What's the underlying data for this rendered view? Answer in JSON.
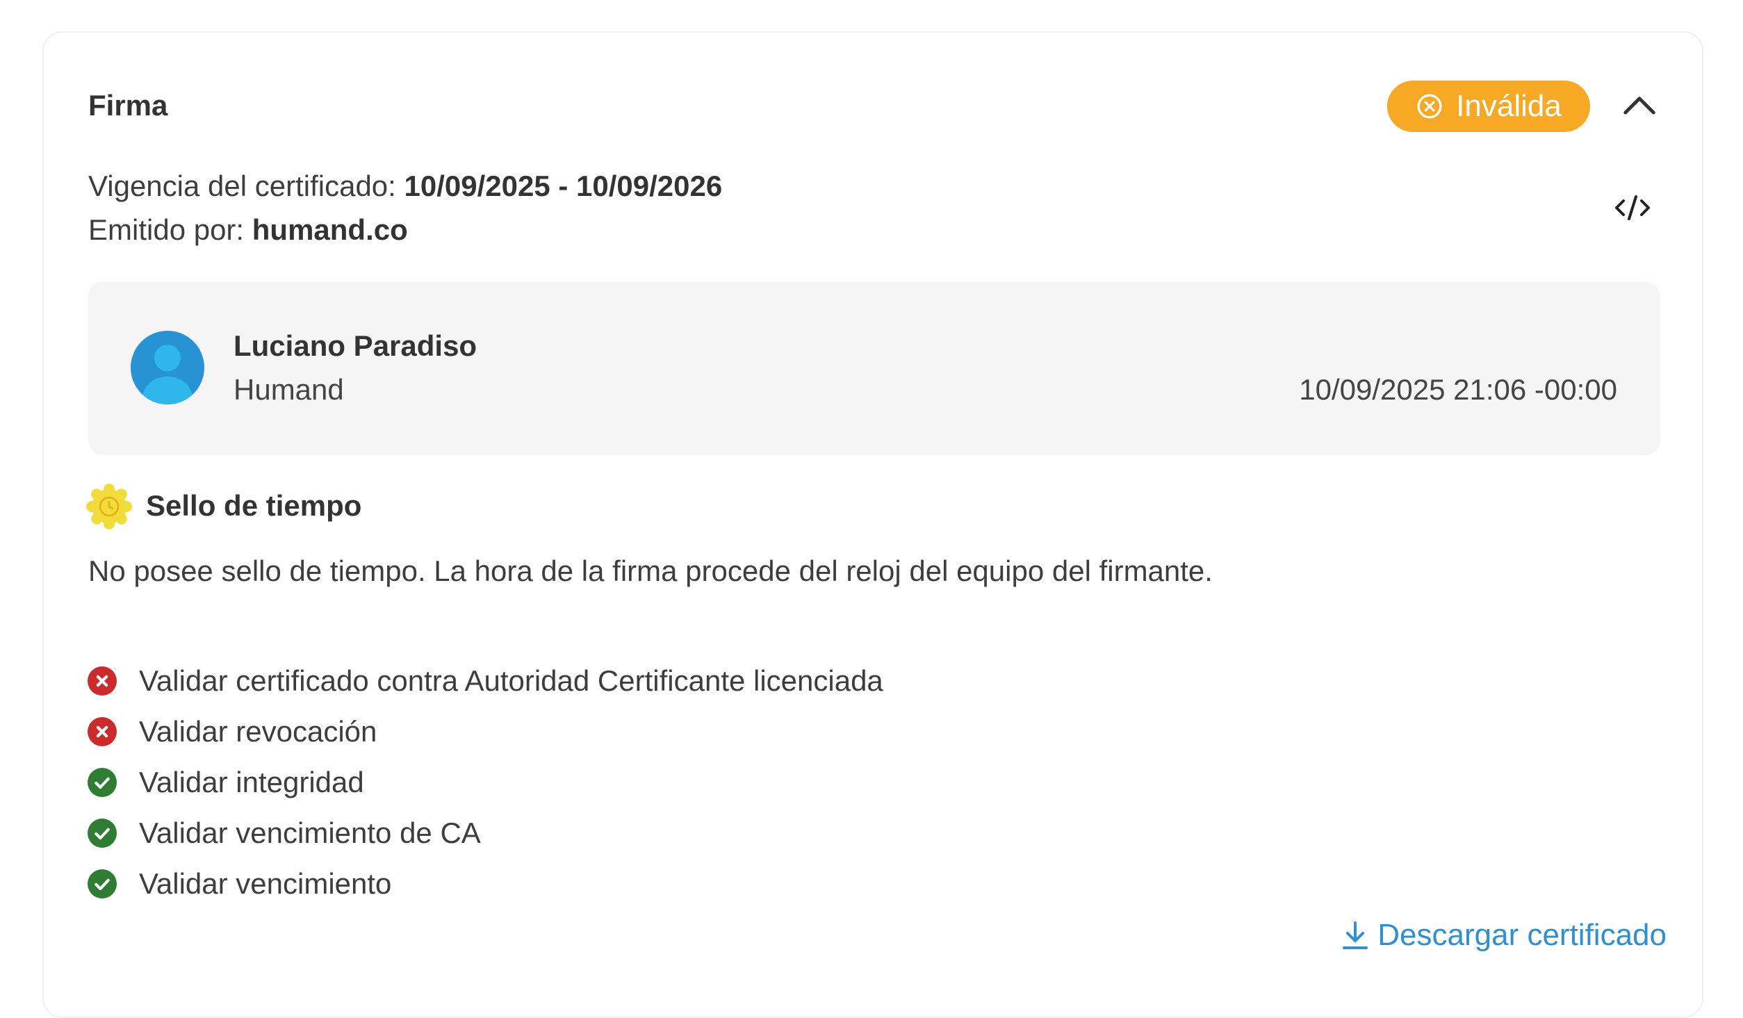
{
  "section": {
    "title": "Firma"
  },
  "status": {
    "label": "Inválida",
    "color": "#f7a824",
    "icon": "x-circle-icon"
  },
  "certificate": {
    "validity_label": "Vigencia del certificado:",
    "validity_value": "10/09/2025 - 10/09/2026",
    "issuer_label": "Emitido por:",
    "issuer_value": "humand.co"
  },
  "signer": {
    "name": "Luciano Paradiso",
    "organization": "Humand",
    "timestamp": "10/09/2025 21:06 -00:00",
    "avatar_icon": "user-avatar-icon"
  },
  "timestamp_seal": {
    "title": "Sello de tiempo",
    "description": "No posee sello de tiempo. La hora de la firma procede del reloj del equipo del firmante."
  },
  "validations": [
    {
      "label": "Validar certificado contra Autoridad Certificante licenciada",
      "status": "error"
    },
    {
      "label": "Validar revocación",
      "status": "error"
    },
    {
      "label": "Validar integridad",
      "status": "ok"
    },
    {
      "label": "Validar vencimiento de CA",
      "status": "ok"
    },
    {
      "label": "Validar vencimiento",
      "status": "ok"
    }
  ],
  "colors": {
    "error": "#cc2b2b",
    "ok": "#2e7d32",
    "link": "#2f8fd0",
    "seal": "#f2dc3c"
  },
  "actions": {
    "download_label": "Descargar certificado"
  }
}
